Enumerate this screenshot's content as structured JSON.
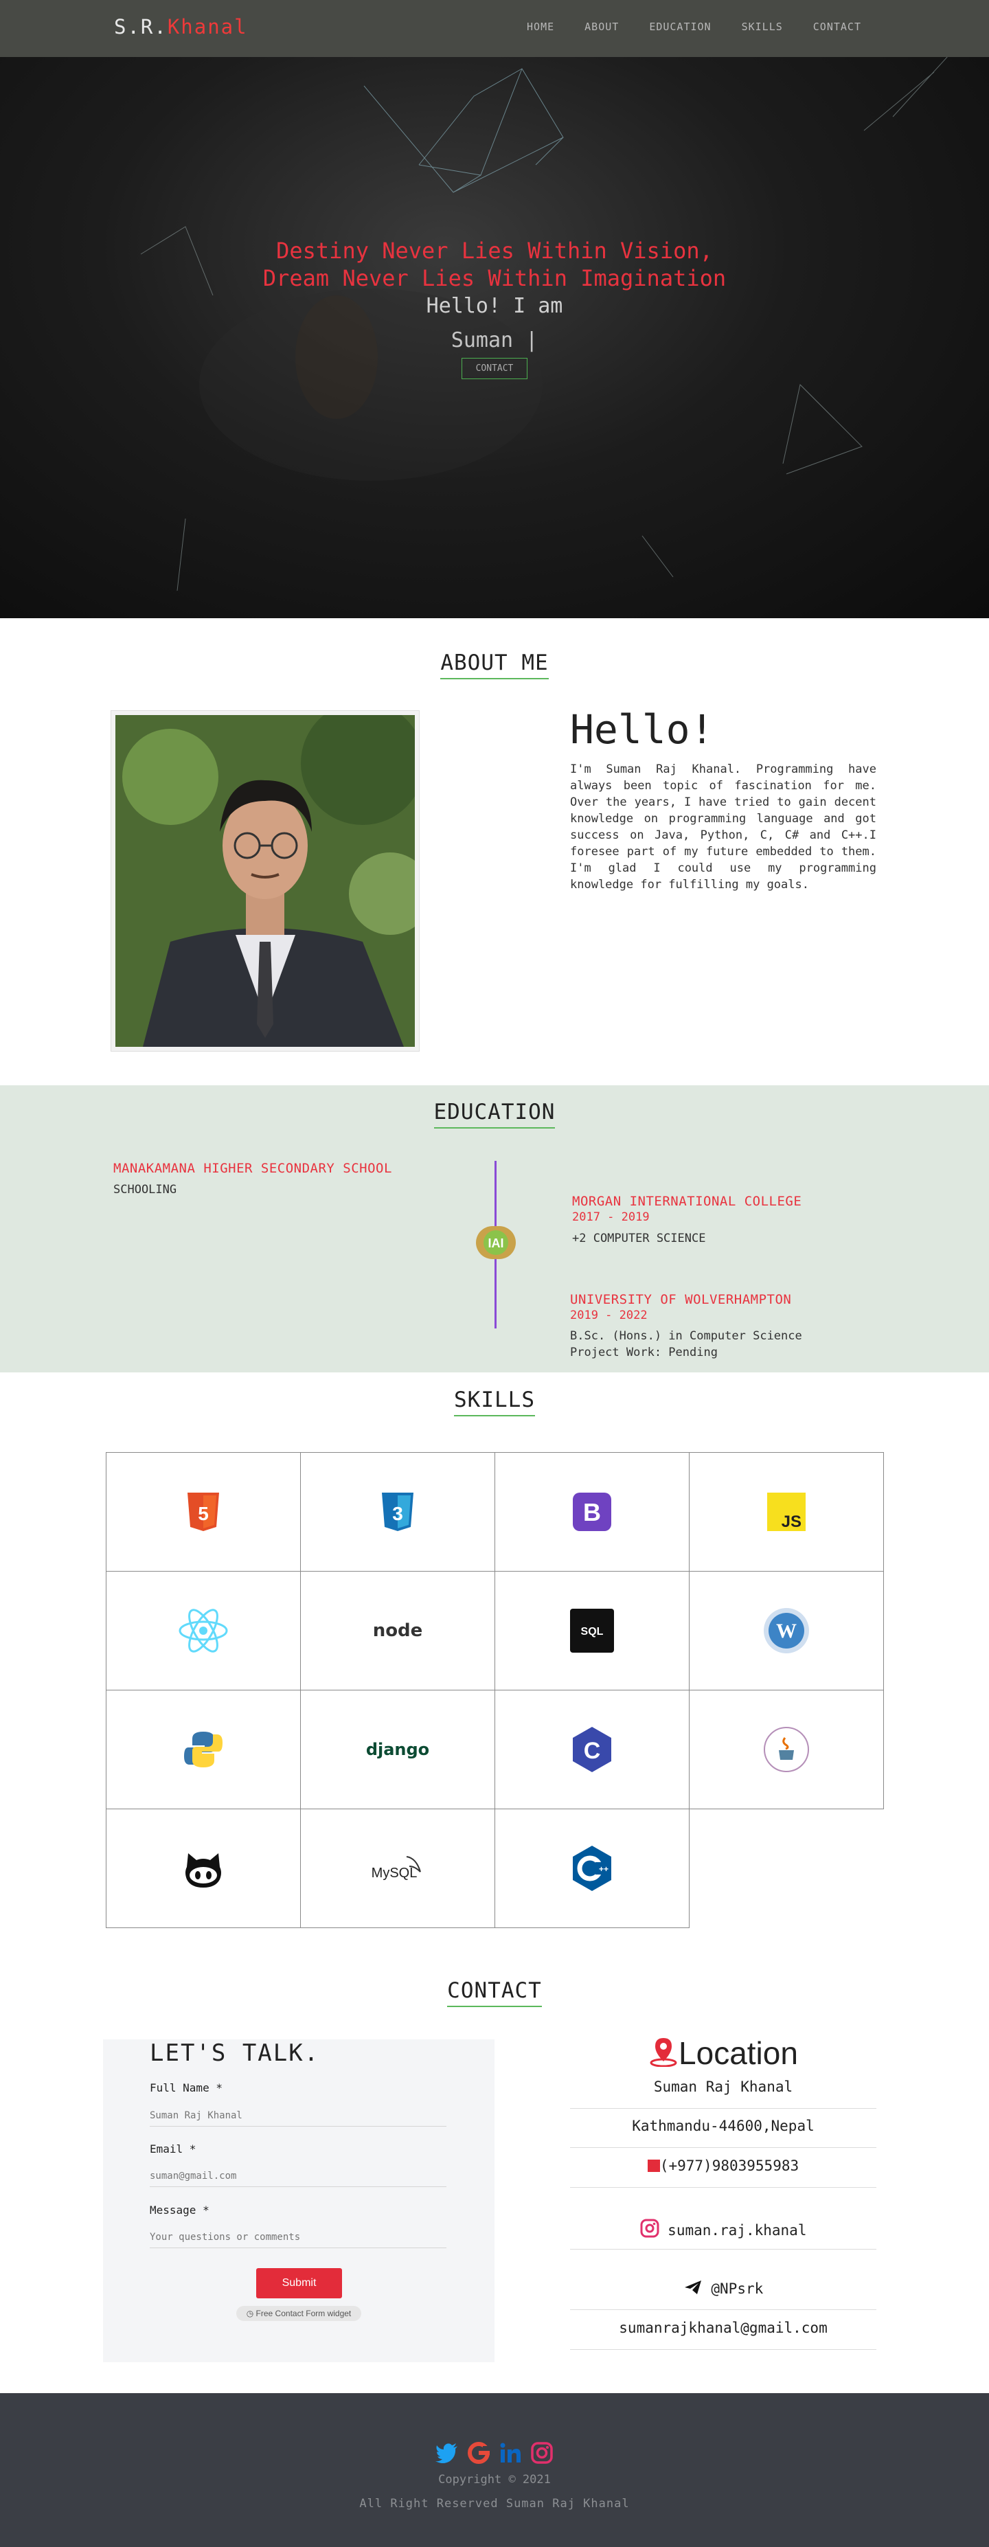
{
  "nav": {
    "brand_prefix": "S.R.",
    "brand_accent": "Khanal",
    "links": [
      "HOME",
      "ABOUT",
      "EDUCATION",
      "SKILLS",
      "CONTACT"
    ]
  },
  "hero": {
    "quote_line1": "Destiny Never Lies Within Vision,",
    "quote_line2": "Dream Never Lies Within Imagination",
    "greeting": "Hello! I am",
    "typed_text": "Suman |",
    "button_label": "CONTACT"
  },
  "about": {
    "title": "ABOUT ME",
    "heading": "Hello!",
    "body": "I'm Suman Raj Khanal. Programming have always been topic of fascination for me. Over the years, I have tried to gain decent knowledge on programming language and got success on Java, Python, C, C# and C++.I foresee part of my future embedded to them. I'm glad I could use my programming knowledge for fulfilling my goals."
  },
  "education": {
    "title": "EDUCATION",
    "entries": [
      {
        "school": "MANAKAMANA HIGHER SECONDARY SCHOOL",
        "years": "",
        "detail": "SCHOOLING",
        "detail2": ""
      },
      {
        "school": "MORGAN INTERNATIONAL COLLEGE",
        "years": "2017 - 2019",
        "detail": "+2 COMPUTER SCIENCE",
        "detail2": ""
      },
      {
        "school": "UNIVERSITY OF WOLVERHAMPTON",
        "years": "2019 - 2022",
        "detail": "B.Sc. (Hons.) in Computer Science",
        "detail2": "Project Work: Pending"
      }
    ]
  },
  "skills": {
    "title": "SKILLS",
    "items": [
      {
        "icon": "html5-icon",
        "label": "5"
      },
      {
        "icon": "css3-icon",
        "label": "3"
      },
      {
        "icon": "bootstrap-icon",
        "label": "B"
      },
      {
        "icon": "javascript-icon",
        "label": "JS"
      },
      {
        "icon": "react-icon",
        "label": ""
      },
      {
        "icon": "nodejs-icon",
        "label": "node"
      },
      {
        "icon": "sql-icon",
        "label": "SQL"
      },
      {
        "icon": "wordpress-icon",
        "label": "W"
      },
      {
        "icon": "python-icon",
        "label": ""
      },
      {
        "icon": "django-icon",
        "label": "django"
      },
      {
        "icon": "c-language-icon",
        "label": "C"
      },
      {
        "icon": "java-icon",
        "label": ""
      },
      {
        "icon": "github-icon",
        "label": ""
      },
      {
        "icon": "mysql-icon",
        "label": "MySQL"
      },
      {
        "icon": "cpp-icon",
        "label": "C++"
      }
    ]
  },
  "contact": {
    "title": "CONTACT",
    "form": {
      "heading": "LET'S TALK.",
      "name_label": "Full Name *",
      "name_placeholder": "Suman Raj Khanal",
      "email_label": "Email *",
      "email_placeholder": "suman@gmail.com",
      "message_label": "Message *",
      "message_placeholder": "Your questions or comments",
      "submit_label": "Submit",
      "widget_badge": "Free Contact Form widget"
    },
    "info": {
      "heading": "Location",
      "name": "Suman Raj Khanal",
      "address": "Kathmandu-44600,Nepal",
      "phone": "(+977)9803955983",
      "instagram": "suman.raj.khanal",
      "telegram": "@NPsrk",
      "email": "sumanrajkhanal@gmail.com"
    }
  },
  "footer": {
    "copyright": "Copyright © 2021",
    "rights": "All Right Reserved Suman Raj Khanal"
  },
  "colors": {
    "accent_red": "#e8333f",
    "underline_green": "#5cb85c",
    "navbar": "#484a45",
    "education_bg": "#dfe8e0",
    "footer_bg": "#3b3e45",
    "timeline_purple": "#8a4bd6"
  }
}
